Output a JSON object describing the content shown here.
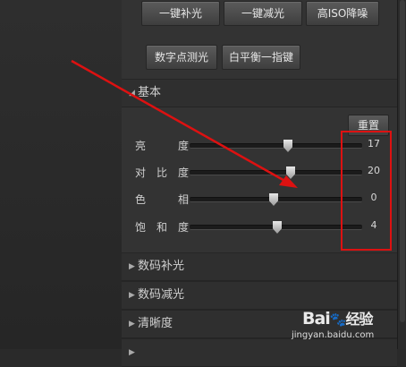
{
  "toolbar": {
    "row1": [
      "一键补光",
      "一键减光",
      "高ISO降噪"
    ],
    "row2": [
      "数字点测光",
      "白平衡一指键"
    ]
  },
  "basic": {
    "title": "基本",
    "reset_label": "重置",
    "rows": [
      {
        "label_chars": [
          "亮",
          "度"
        ],
        "value": "17"
      },
      {
        "label_chars": [
          "对",
          "比",
          "度"
        ],
        "value": "20"
      },
      {
        "label_chars": [
          "色",
          "相"
        ],
        "value": "0"
      },
      {
        "label_chars": [
          "饱",
          "和",
          "度"
        ],
        "value": "4"
      }
    ]
  },
  "sections": [
    "数码补光",
    "数码减光",
    "清晰度"
  ],
  "watermark": {
    "brand": "Bai",
    "brand2": "经验",
    "site": "jingyan.baidu.com"
  },
  "colors": {
    "highlight": "#dd1111",
    "panel": "#333333"
  }
}
